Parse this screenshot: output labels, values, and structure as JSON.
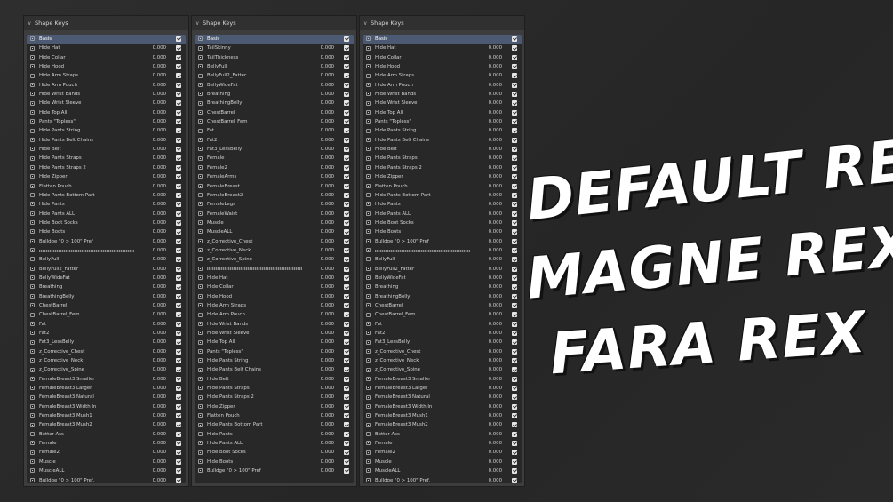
{
  "panels": [
    {
      "header": "Shape Keys",
      "rows": [
        {
          "name": "Basis",
          "value": ""
        },
        {
          "name": "Hide Hat",
          "value": "0.000"
        },
        {
          "name": "Hide Collar",
          "value": "0.000"
        },
        {
          "name": "Hide Hood",
          "value": "0.000"
        },
        {
          "name": "Hide Arm Straps",
          "value": "0.000"
        },
        {
          "name": "Hide Arm Pouch",
          "value": "0.000"
        },
        {
          "name": "Hide Wrist Bands",
          "value": "0.000"
        },
        {
          "name": "Hide Wrist Sleeve",
          "value": "0.000"
        },
        {
          "name": "Hide Top All",
          "value": "0.000"
        },
        {
          "name": "Pants \"Topless\"",
          "value": "0.000"
        },
        {
          "name": "Hide Pants String",
          "value": "0.000"
        },
        {
          "name": "Hide Pants Belt Chains",
          "value": "0.000"
        },
        {
          "name": "Hide Belt",
          "value": "0.000"
        },
        {
          "name": "Hide Pants Straps",
          "value": "0.000"
        },
        {
          "name": "Hide Pants Straps 2",
          "value": "0.000"
        },
        {
          "name": "Hide Zipper",
          "value": "0.000"
        },
        {
          "name": "Flatten Pouch",
          "value": "0.000"
        },
        {
          "name": "Hide Pants Bottom Part",
          "value": "0.000"
        },
        {
          "name": "Hide Pants",
          "value": "0.000"
        },
        {
          "name": "Hide Pants ALL",
          "value": "0.000"
        },
        {
          "name": "Hide Boot Socks",
          "value": "0.000"
        },
        {
          "name": "Hide Boots",
          "value": "0.000"
        },
        {
          "name": "Bulldge \"0 > 100\" Pref",
          "value": "0.000"
        },
        {
          "name": "",
          "value": "0.000",
          "divider": true
        },
        {
          "name": "BellyFull",
          "value": "0.000"
        },
        {
          "name": "BellyFull2_Fatter",
          "value": "0.000"
        },
        {
          "name": "BellyWideFat",
          "value": "0.000"
        },
        {
          "name": "Breathing",
          "value": "0.000"
        },
        {
          "name": "BreathingBelly",
          "value": "0.000"
        },
        {
          "name": "ChestBarrel",
          "value": "0.000"
        },
        {
          "name": "ChestBarrel_Fem",
          "value": "0.000"
        },
        {
          "name": "Fat",
          "value": "0.000"
        },
        {
          "name": "Fat2",
          "value": "0.000"
        },
        {
          "name": "Fat3_LessBelly",
          "value": "0.000"
        },
        {
          "name": "z_Corrective_Chest",
          "value": "0.000"
        },
        {
          "name": "z_Corrective_Neck",
          "value": "0.000"
        },
        {
          "name": "z_Corrective_Spine",
          "value": "0.000"
        },
        {
          "name": "FemaleBreast3 Smaller",
          "value": "0.000"
        },
        {
          "name": "FemaleBreast3 Larger",
          "value": "0.000"
        },
        {
          "name": "FemaleBreast3 Natural",
          "value": "0.000"
        },
        {
          "name": "FemaleBreast3 Width In",
          "value": "0.000"
        },
        {
          "name": "FemaleBreast3 Mush1",
          "value": "0.000"
        },
        {
          "name": "FemaleBreast3 Mush2",
          "value": "0.000"
        },
        {
          "name": "Better Ass",
          "value": "0.000"
        },
        {
          "name": "Female",
          "value": "0.000"
        },
        {
          "name": "Female2",
          "value": "0.000"
        },
        {
          "name": "Muscle",
          "value": "0.000"
        },
        {
          "name": "MuscleALL",
          "value": "0.000"
        },
        {
          "name": "Bulldge \"0 > 100\" Pref.",
          "value": "0.000"
        }
      ]
    },
    {
      "header": "Shape Keys",
      "rows": [
        {
          "name": "Basis",
          "value": ""
        },
        {
          "name": "TailSkinny",
          "value": "0.000"
        },
        {
          "name": "TailThickness",
          "value": "0.000"
        },
        {
          "name": "BellyFull",
          "value": "0.000"
        },
        {
          "name": "BellyFull2_Fatter",
          "value": "0.000"
        },
        {
          "name": "BellyWideFat",
          "value": "0.000"
        },
        {
          "name": "Breathing",
          "value": "0.000"
        },
        {
          "name": "BreathingBelly",
          "value": "0.000"
        },
        {
          "name": "ChestBarrel",
          "value": "0.000"
        },
        {
          "name": "ChestBarrel_Fem",
          "value": "0.000"
        },
        {
          "name": "Fat",
          "value": "0.000"
        },
        {
          "name": "Fat2",
          "value": "0.000"
        },
        {
          "name": "Fat3_LessBelly",
          "value": "0.000"
        },
        {
          "name": "Female",
          "value": "0.000"
        },
        {
          "name": "Female2",
          "value": "0.000"
        },
        {
          "name": "FemaleArms",
          "value": "0.000"
        },
        {
          "name": "FemaleBreast",
          "value": "0.000"
        },
        {
          "name": "FemaleBreast2",
          "value": "0.000"
        },
        {
          "name": "FemaleLegs",
          "value": "0.000"
        },
        {
          "name": "FemaleWaist",
          "value": "0.000"
        },
        {
          "name": "Muscle",
          "value": "0.000"
        },
        {
          "name": "MuscleALL",
          "value": "0.000"
        },
        {
          "name": "z_Corrective_Chest",
          "value": "0.000"
        },
        {
          "name": "z_Corrective_Neck",
          "value": "0.000"
        },
        {
          "name": "z_Corrective_Spine",
          "value": "0.000"
        },
        {
          "name": "",
          "value": "0.000",
          "divider": true
        },
        {
          "name": "Hide Hat",
          "value": "0.000"
        },
        {
          "name": "Hide Collar",
          "value": "0.000"
        },
        {
          "name": "Hide Hood",
          "value": "0.000"
        },
        {
          "name": "Hide Arm Straps",
          "value": "0.000"
        },
        {
          "name": "Hide Arm Pouch",
          "value": "0.000"
        },
        {
          "name": "Hide Wrist Bands",
          "value": "0.000"
        },
        {
          "name": "Hide Wrist Sleeve",
          "value": "0.000"
        },
        {
          "name": "Hide Top All",
          "value": "0.000"
        },
        {
          "name": "Pants \"Topless\"",
          "value": "0.000"
        },
        {
          "name": "Hide Pants String",
          "value": "0.000"
        },
        {
          "name": "Hide Pants Belt Chains",
          "value": "0.000"
        },
        {
          "name": "Hide Belt",
          "value": "0.000"
        },
        {
          "name": "Hide Pants Straps",
          "value": "0.000"
        },
        {
          "name": "Hide Pants Straps 2",
          "value": "0.000"
        },
        {
          "name": "Hide Zipper",
          "value": "0.000"
        },
        {
          "name": "Flatten Pouch",
          "value": "0.000"
        },
        {
          "name": "Hide Pants Bottom Part",
          "value": "0.000"
        },
        {
          "name": "Hide Pants",
          "value": "0.000"
        },
        {
          "name": "Hide Pants ALL",
          "value": "0.000"
        },
        {
          "name": "Hide Boot Socks",
          "value": "0.000"
        },
        {
          "name": "Hide Boots",
          "value": "0.000"
        },
        {
          "name": "Bulldge \"0 > 100\" Pref",
          "value": "0.000"
        }
      ]
    },
    {
      "header": "Shape Keys",
      "rows": [
        {
          "name": "Basis",
          "value": ""
        },
        {
          "name": "Hide Hat",
          "value": "0.000"
        },
        {
          "name": "Hide Collar",
          "value": "0.000"
        },
        {
          "name": "Hide Hood",
          "value": "0.000"
        },
        {
          "name": "Hide Arm Straps",
          "value": "0.000"
        },
        {
          "name": "Hide Arm Pouch",
          "value": "0.000"
        },
        {
          "name": "Hide Wrist Bands",
          "value": "0.000"
        },
        {
          "name": "Hide Wrist Sleeve",
          "value": "0.000"
        },
        {
          "name": "Hide Top All",
          "value": "0.000"
        },
        {
          "name": "Pants \"Topless\"",
          "value": "0.000"
        },
        {
          "name": "Hide Pants String",
          "value": "0.000"
        },
        {
          "name": "Hide Pants Belt Chains",
          "value": "0.000"
        },
        {
          "name": "Hide Belt",
          "value": "0.000"
        },
        {
          "name": "Hide Pants Straps",
          "value": "0.000"
        },
        {
          "name": "Hide Pants Straps 2",
          "value": "0.000"
        },
        {
          "name": "Hide Zipper",
          "value": "0.000"
        },
        {
          "name": "Flatten Pouch",
          "value": "0.000"
        },
        {
          "name": "Hide Pants Bottom Part",
          "value": "0.000"
        },
        {
          "name": "Hide Pants",
          "value": "0.000"
        },
        {
          "name": "Hide Pants ALL",
          "value": "0.000"
        },
        {
          "name": "Hide Boot Socks",
          "value": "0.000"
        },
        {
          "name": "Hide Boots",
          "value": "0.000"
        },
        {
          "name": "Bulldge \"0 > 100\" Pref",
          "value": "0.000"
        },
        {
          "name": "",
          "value": "0.000",
          "divider": true
        },
        {
          "name": "BellyFull",
          "value": "0.000"
        },
        {
          "name": "BellyFull2_Fatter",
          "value": "0.000"
        },
        {
          "name": "BellyWideFat",
          "value": "0.000"
        },
        {
          "name": "Breathing",
          "value": "0.000"
        },
        {
          "name": "BreathingBelly",
          "value": "0.000"
        },
        {
          "name": "ChestBarrel",
          "value": "0.000"
        },
        {
          "name": "ChestBarrel_Fem",
          "value": "0.000"
        },
        {
          "name": "Fat",
          "value": "0.000"
        },
        {
          "name": "Fat2",
          "value": "0.000"
        },
        {
          "name": "Fat3_LessBelly",
          "value": "0.000"
        },
        {
          "name": "z_Corrective_Chest",
          "value": "0.000"
        },
        {
          "name": "z_Corrective_Neck",
          "value": "0.000"
        },
        {
          "name": "z_Corrective_Spine",
          "value": "0.000"
        },
        {
          "name": "FemaleBreast3 Smaller",
          "value": "0.000"
        },
        {
          "name": "FemaleBreast3 Larger",
          "value": "0.000"
        },
        {
          "name": "FemaleBreast3 Natural",
          "value": "0.000"
        },
        {
          "name": "FemaleBreast3 Width In",
          "value": "0.000"
        },
        {
          "name": "FemaleBreast3 Mush1",
          "value": "0.000"
        },
        {
          "name": "FemaleBreast3 Mush2",
          "value": "0.000"
        },
        {
          "name": "Better Ass",
          "value": "0.000"
        },
        {
          "name": "Female",
          "value": "0.000"
        },
        {
          "name": "Female2",
          "value": "0.000"
        },
        {
          "name": "Muscle",
          "value": "0.000"
        },
        {
          "name": "MuscleALL",
          "value": "0.000"
        },
        {
          "name": "Bulldge \"0 > 100\" Pref.",
          "value": "0.000"
        }
      ]
    }
  ],
  "overlay": {
    "line1": "DEFAULT REX",
    "line2": "MAGNE REX",
    "line3": "FARA REX"
  },
  "colors": {
    "panel_bg": "#3d3d3d",
    "list_bg": "#282828",
    "active_row": "#4b5a72",
    "text": "#d4d4d4",
    "overlay_text": "#ffffff"
  },
  "icons": {
    "header_toggle": "chevron-down-icon",
    "row_icon": "shape-key-icon",
    "row_toggle": "checkbox-checked-icon"
  }
}
